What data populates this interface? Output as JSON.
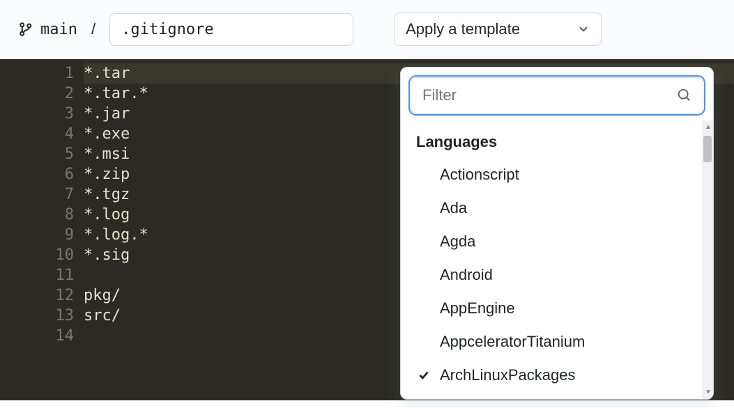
{
  "branch": {
    "name": "main"
  },
  "path_separator": "/",
  "filename": {
    "value": ".gitignore"
  },
  "template_button": {
    "label": "Apply a template"
  },
  "editor": {
    "lines": [
      "*.tar",
      "*.tar.*",
      "*.jar",
      "*.exe",
      "*.msi",
      "*.zip",
      "*.tgz",
      "*.log",
      "*.log.*",
      "*.sig",
      "",
      "pkg/",
      "src/",
      ""
    ],
    "highlighted_line_index": 0
  },
  "dropdown": {
    "filter_placeholder": "Filter",
    "heading": "Languages",
    "items": [
      {
        "label": "Actionscript",
        "selected": false
      },
      {
        "label": "Ada",
        "selected": false
      },
      {
        "label": "Agda",
        "selected": false
      },
      {
        "label": "Android",
        "selected": false
      },
      {
        "label": "AppEngine",
        "selected": false
      },
      {
        "label": "AppceleratorTitanium",
        "selected": false
      },
      {
        "label": "ArchLinuxPackages",
        "selected": true
      }
    ]
  }
}
